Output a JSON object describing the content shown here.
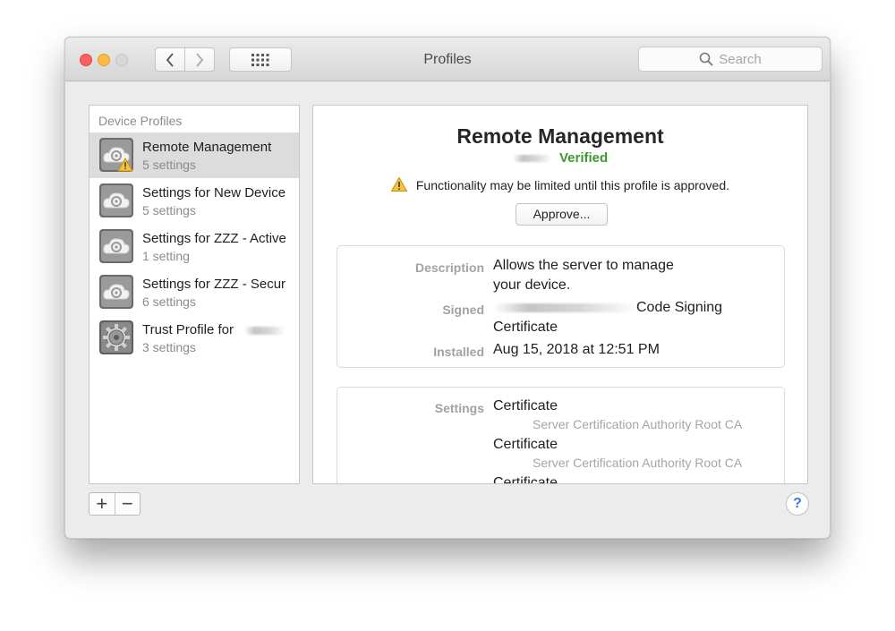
{
  "window": {
    "title": "Profiles",
    "search_placeholder": "Search"
  },
  "sidebar": {
    "header": "Device Profiles",
    "items": [
      {
        "title": "Remote Management",
        "subtitle": "5 settings",
        "selected": true,
        "icon": "settings-cloud-warning-icon"
      },
      {
        "title": "Settings for New Device",
        "subtitle": "5 settings",
        "selected": false,
        "icon": "settings-cloud-icon"
      },
      {
        "title": "Settings for ZZZ - Active",
        "subtitle": "1 setting",
        "selected": false,
        "icon": "settings-cloud-icon"
      },
      {
        "title": "Settings for ZZZ - Secur",
        "subtitle": "6 settings",
        "selected": false,
        "icon": "settings-cloud-icon"
      },
      {
        "title": "Trust Profile for",
        "subtitle": "3 settings",
        "selected": false,
        "icon": "gear-icon"
      }
    ],
    "add_label": "+",
    "remove_label": "−"
  },
  "detail": {
    "title": "Remote Management",
    "status": "Verified",
    "warning": "Functionality may be limited until this profile is approved.",
    "approve_label": "Approve...",
    "info": {
      "description_label": "Description",
      "description_line1": "Allows the server to manage",
      "description_line2": "your device.",
      "signed_label": "Signed",
      "signed_value_suffix": "Code Signing",
      "signed_value_line2": "Certificate",
      "installed_label": "Installed",
      "installed_value": "Aug 15, 2018 at 12:51 PM"
    },
    "settings": {
      "label": "Settings",
      "entries": [
        {
          "name": "Certificate",
          "detail": "Server Certification Authority Root CA"
        },
        {
          "name": "Certificate",
          "detail": "Server Certification Authority Root CA"
        },
        {
          "name": "Certificate",
          "detail": ""
        }
      ]
    }
  },
  "help_label": "?",
  "colors": {
    "verified": "#3a9b2c",
    "help_accent": "#2f7df6",
    "selection": "#dcdcdc"
  }
}
